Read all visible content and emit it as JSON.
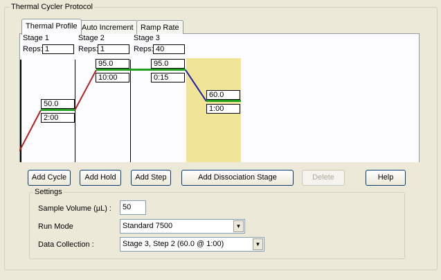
{
  "window": {
    "group_title": "Thermal Cycler Protocol"
  },
  "tabs": [
    {
      "label": "Thermal Profile"
    },
    {
      "label": "Auto Increment"
    },
    {
      "label": "Ramp Rate"
    }
  ],
  "profile": {
    "reps_label": "Reps:",
    "stages": [
      {
        "name": "Stage 1",
        "reps": "1"
      },
      {
        "name": "Stage 2",
        "reps": "1"
      },
      {
        "name": "Stage 3",
        "reps": "40"
      }
    ],
    "steps": [
      {
        "temp": "50.0",
        "time": "2:00"
      },
      {
        "temp": "95.0",
        "time": "10:00"
      },
      {
        "temp": "95.0",
        "time": "0:15"
      },
      {
        "temp": "60.0",
        "time": "1:00"
      }
    ],
    "colors": {
      "ramp_up": "#b22222",
      "ramp_down": "#1a1aa8",
      "hold": "#1ea01e",
      "selected_step": "#f0e496"
    }
  },
  "buttons": {
    "add_cycle": "Add Cycle",
    "add_hold": "Add Hold",
    "add_step": "Add Step",
    "add_dissociation": "Add Dissociation Stage",
    "delete": "Delete",
    "help": "Help"
  },
  "settings": {
    "title": "Settings",
    "sample_volume_label": "Sample Volume (µL) :",
    "sample_volume_value": "50",
    "run_mode_label": "Run Mode",
    "run_mode_value": "Standard 7500",
    "data_collection_label": "Data Collection :",
    "data_collection_value": "Stage 3, Step 2 (60.0 @ 1:00)"
  }
}
